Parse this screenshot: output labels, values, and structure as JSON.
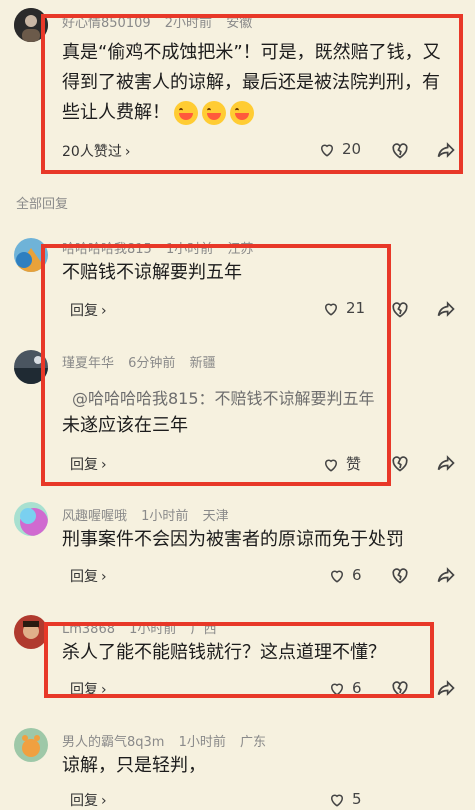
{
  "top_comment": {
    "user": "好心情850109",
    "time": "2小时前",
    "location": "安徽",
    "text": "真是“偷鸡不成蚀把米”！可是，既然赔了钱，又得到了被害人的谅解，最后还是被法院判刑，有些让人费解！",
    "liked_by": "20人赞过",
    "like_count": "20"
  },
  "section_label": "全部回复",
  "replies": [
    {
      "user": "哈哈哈哈我815",
      "time": "1小时前",
      "location": "江苏",
      "text": "不赔钱不谅解要判五年",
      "reply_label": "回复",
      "like_count": "21"
    },
    {
      "user": "瑾夏年华",
      "time": "6分钟前",
      "location": "新疆",
      "quote": "@哈哈哈哈我815：不赔钱不谅解要判五年",
      "text": "未遂应该在三年",
      "reply_label": "回复",
      "like_count": "赞"
    },
    {
      "user": "风趣喔喔哦",
      "time": "1小时前",
      "location": "天津",
      "text": "刑事案件不会因为被害者的原谅而免于处罚",
      "reply_label": "回复",
      "like_count": "6"
    },
    {
      "user": "Lm3868",
      "time": "1小时前",
      "location": "广西",
      "text": "杀人了能不能赔钱就行？这点道理不懂？",
      "reply_label": "回复",
      "like_count": "6"
    },
    {
      "user": "男人的霸气8q3m",
      "time": "1小时前",
      "location": "广东",
      "text": "谅解，只是轻判，",
      "reply_label": "回复",
      "like_count": "5"
    }
  ],
  "icons": {
    "like": "thumbs-up-icon",
    "dislike": "broken-heart-icon",
    "share": "share-icon",
    "chevron": "chevron-right-icon"
  },
  "colors": {
    "background": "#f6f1df",
    "highlight_border": "#e83828"
  }
}
